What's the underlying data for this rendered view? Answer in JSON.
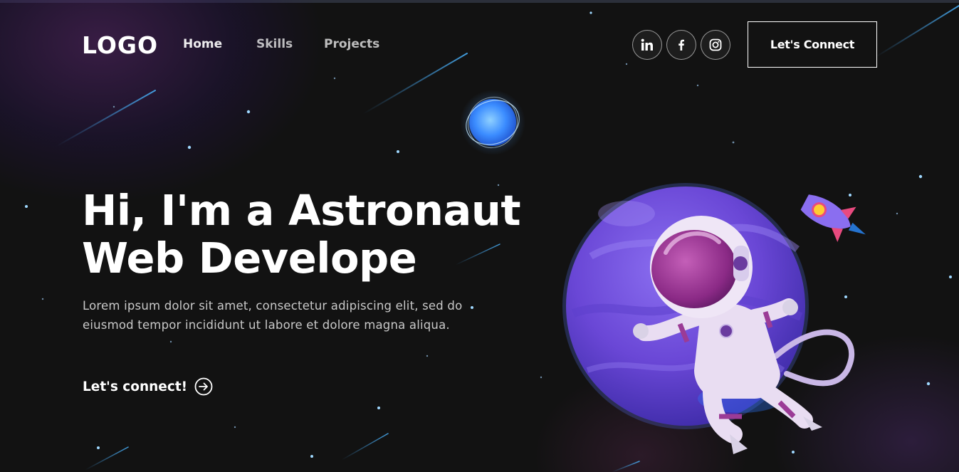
{
  "nav": {
    "logo": "LOGO",
    "links": [
      {
        "label": "Home"
      },
      {
        "label": "Skills"
      },
      {
        "label": "Projects"
      }
    ],
    "social": [
      "linkedin-icon",
      "facebook-icon",
      "instagram-icon"
    ],
    "cta_label": "Let's Connect"
  },
  "hero": {
    "title_line1": "Hi, I'm a Astronaut",
    "title_line2": "Web Develope",
    "text": "Lorem ipsum dolor sit amet, consectetur adipiscing elit, sed do eiusmod tempor incididunt ut labore et dolore magna aliqua.",
    "cta_label": "Let's connect!"
  },
  "colors": {
    "background": "#121212",
    "accent_purple": "#6b4fd8",
    "planet_blue": "#4aa3ff"
  }
}
